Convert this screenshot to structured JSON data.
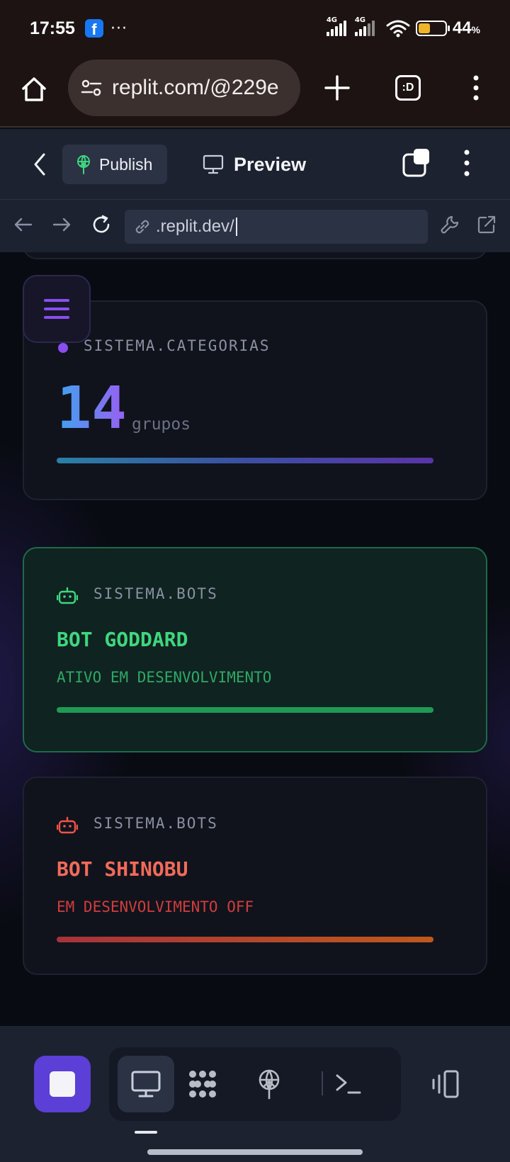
{
  "status_bar": {
    "time": "17:55",
    "facebook_letter": "f",
    "more": "···",
    "network_1": "4G",
    "network_2": "4G",
    "battery_level": 0.44,
    "battery_pct": "44",
    "battery_unit": "%"
  },
  "browser": {
    "url": "replit.com/@229e",
    "tab_switcher_label": ":D"
  },
  "replit_toolbar": {
    "publish_label": "Publish",
    "preview_label": "Preview"
  },
  "webview_nav": {
    "url": ".replit.dev/"
  },
  "page": {
    "categories_card": {
      "label": "SISTEMA.CATEGORIAS",
      "count": "14",
      "unit": "grupos"
    },
    "bots": [
      {
        "label": "SISTEMA.BOTS",
        "name": "BOT GODDARD",
        "status": "ATIVO EM DESENVOLVIMENTO",
        "color": "#3fd67f"
      },
      {
        "label": "SISTEMA.BOTS",
        "name": "BOT SHINOBU",
        "status": "EM DESENVOLVIMENTO OFF",
        "color": "#f56a5a"
      }
    ]
  },
  "colors": {
    "accent_purple": "#8a4df0",
    "stop_button": "#5b3fd6",
    "active_green": "#3fd67f",
    "off_red": "#d13d3d"
  }
}
